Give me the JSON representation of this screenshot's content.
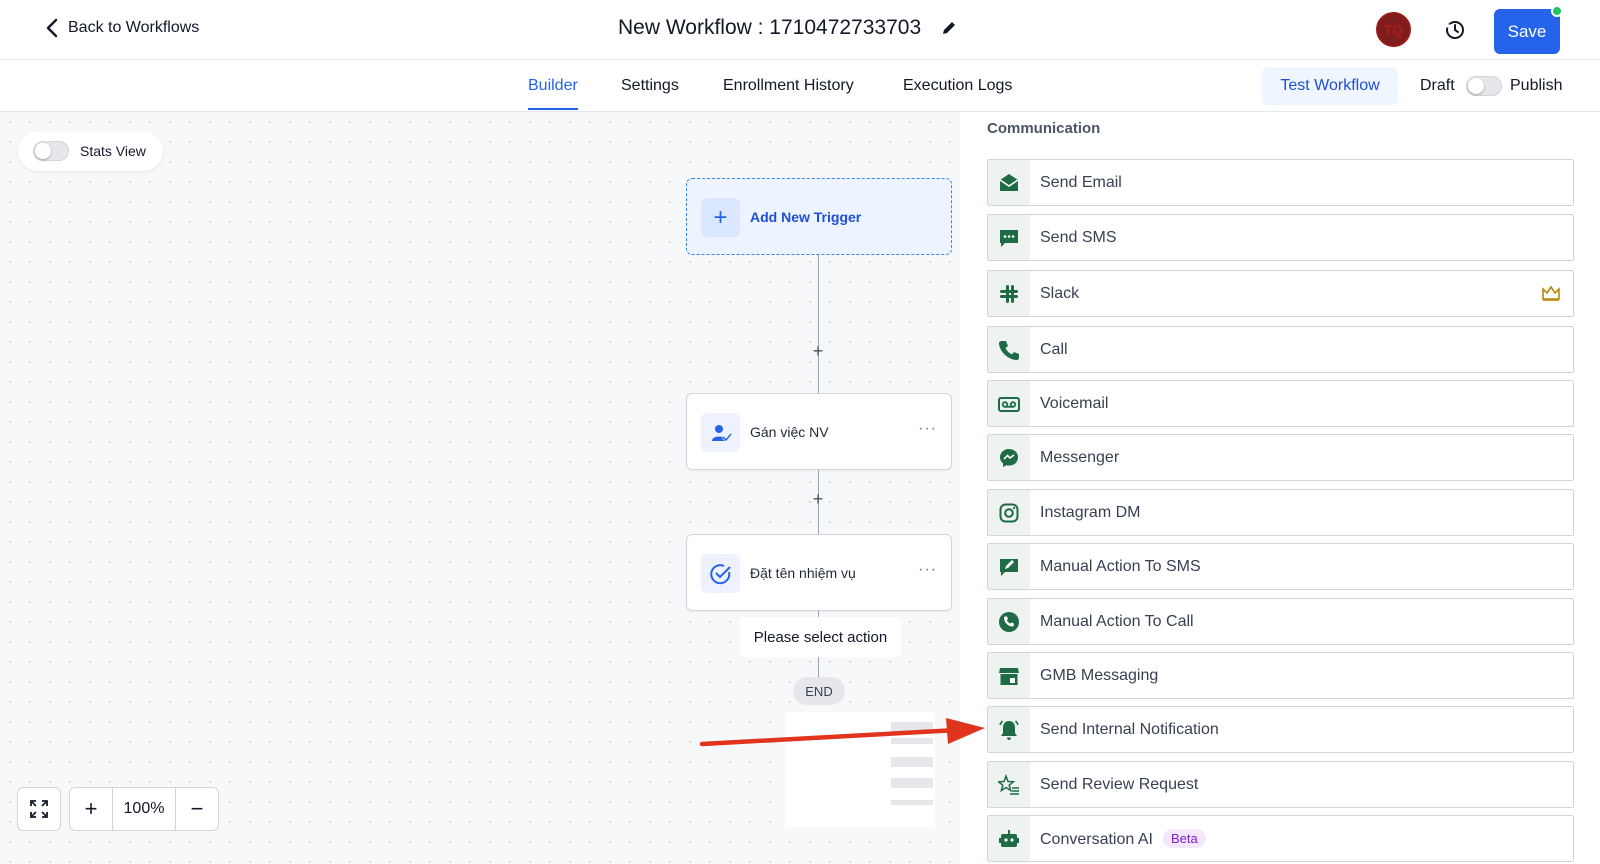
{
  "header": {
    "back_label": "Back to Workflows",
    "workflow_title": "New Workflow : 1710472733703",
    "avatar_initials": "TQ",
    "save_label": "Save"
  },
  "tabs": [
    {
      "label": "Builder",
      "active": true
    },
    {
      "label": "Settings",
      "active": false
    },
    {
      "label": "Enrollment History",
      "active": false
    },
    {
      "label": "Execution Logs",
      "active": false
    }
  ],
  "toolbar": {
    "test_label": "Test Workflow",
    "draft_label": "Draft",
    "publish_label": "Publish",
    "publish_on": false
  },
  "canvas": {
    "stats_view_label": "Stats View",
    "stats_view_on": false,
    "trigger_label": "Add New Trigger",
    "actions": [
      {
        "label": "Gán việc NV",
        "icon": "user-check-icon"
      },
      {
        "label": "Đặt tên nhiệm vụ",
        "icon": "task-check-icon"
      }
    ],
    "select_action_label": "Please select action",
    "end_label": "END",
    "zoom_level": "100%"
  },
  "panel": {
    "section_title": "Communication",
    "items": [
      {
        "label": "Send Email",
        "icon": "email-icon"
      },
      {
        "label": "Send SMS",
        "icon": "sms-icon"
      },
      {
        "label": "Slack",
        "icon": "slack-icon",
        "premium": true
      },
      {
        "label": "Call",
        "icon": "phone-icon"
      },
      {
        "label": "Voicemail",
        "icon": "voicemail-icon"
      },
      {
        "label": "Messenger",
        "icon": "messenger-icon"
      },
      {
        "label": "Instagram DM",
        "icon": "instagram-icon"
      },
      {
        "label": "Manual Action To SMS",
        "icon": "manual-sms-icon"
      },
      {
        "label": "Manual Action To Call",
        "icon": "manual-call-icon"
      },
      {
        "label": "GMB Messaging",
        "icon": "gmb-icon"
      },
      {
        "label": "Send Internal Notification",
        "icon": "bell-icon"
      },
      {
        "label": "Send Review Request",
        "icon": "star-list-icon"
      },
      {
        "label": "Conversation AI",
        "icon": "robot-icon",
        "badge": "Beta"
      }
    ]
  },
  "colors": {
    "accent": "#2563eb",
    "icon_green": "#1e6b45",
    "annotation_arrow": "#e0341e"
  }
}
